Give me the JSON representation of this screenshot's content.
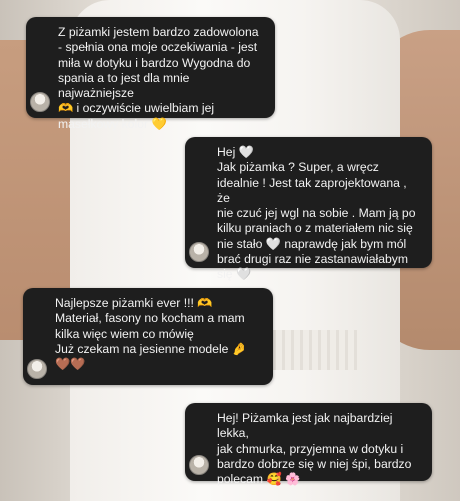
{
  "messages": [
    {
      "text": "Z piżamki jestem bardzo zadowolona\n- spełnia ona moje oczekiwania - jest\nmiła w dotyku i bardzo Wygodna do\nspania a to jest dla mnie najważniejsze\n🫶 i oczywiście uwielbiam jej\nmasełkowy kolor 💛"
    },
    {
      "text": "Hej 🤍\nJak piżamka ? Super, a wręcz\nidealnie ! Jest tak zaprojektowana , że\nnie czuć jej wgl na sobie . Mam ją po\nkilku praniach o z materiałem nic się\nnie stało 🤍 naprawdę jak bym mól\nbrać drugi raz nie zastanawiałabym\nsię 🤍"
    },
    {
      "text": "Najlepsze piżamki ever !!! 🫶\nMateriał, fasony no kocham a mam\nkilka więc wiem co mówię\nJuż czekam na jesienne modele 🤌\n🤎🤎"
    },
    {
      "text": "Hej! Piżamka jest jak najbardziej lekka,\njak chmurka, przyjemna w dotyku i\nbardzo dobrze się w niej śpi, bardzo\npolecam 🥰 🌸"
    }
  ]
}
